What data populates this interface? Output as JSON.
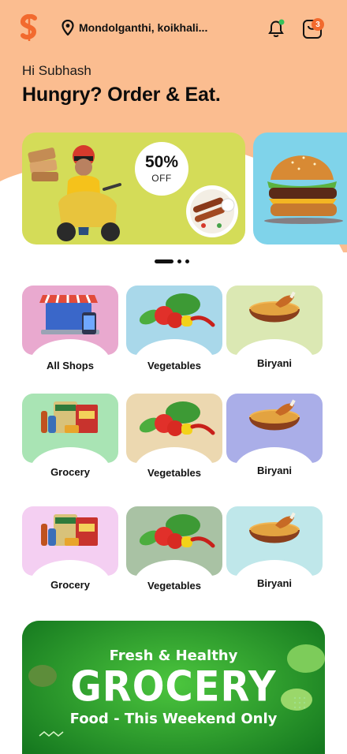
{
  "app": {
    "brand_color": "#f26a2e",
    "hero_color": "#fbbd90"
  },
  "header": {
    "location": "Mondolganthi, koikhali...",
    "cart_count": "3",
    "icons": [
      "logo-s-icon",
      "location-pin-icon",
      "bell-icon",
      "shopping-bag-icon"
    ]
  },
  "greeting": {
    "hi": "Hi Subhash",
    "headline": "Hungry? Order & Eat."
  },
  "banners": [
    {
      "offer_percent": "50%",
      "offer_label": "OFF",
      "bg": "#d4dc58"
    },
    {
      "bg": "#7fd3ea"
    }
  ],
  "carousel": {
    "pages": 3,
    "active": 0
  },
  "categories": [
    {
      "label": "All Shops",
      "bg": "#e9a9cf",
      "icon": "store-icon"
    },
    {
      "label": "Vegetables",
      "bg": "#a9d8ea",
      "icon": "vegetables-icon"
    },
    {
      "label": "Biryani",
      "bg": "#dbe8b3",
      "icon": "biryani-icon"
    },
    {
      "label": "Grocery",
      "bg": "#a9e4b4",
      "icon": "grocery-icon"
    },
    {
      "label": "Vegetables",
      "bg": "#ecd8b0",
      "icon": "vegetables-icon"
    },
    {
      "label": "Biryani",
      "bg": "#aaaee8",
      "icon": "biryani-icon"
    },
    {
      "label": "Grocery",
      "bg": "#f4cff2",
      "icon": "grocery-icon"
    },
    {
      "label": "Vegetables",
      "bg": "#a9c2a4",
      "icon": "vegetables-icon"
    },
    {
      "label": "Biryani",
      "bg": "#bfe7ea",
      "icon": "biryani-icon"
    }
  ],
  "promo": {
    "line1": "Fresh & Healthy",
    "line2": "GROCERY",
    "line3": "Food - This Weekend Only",
    "bg": "#27a22e"
  }
}
